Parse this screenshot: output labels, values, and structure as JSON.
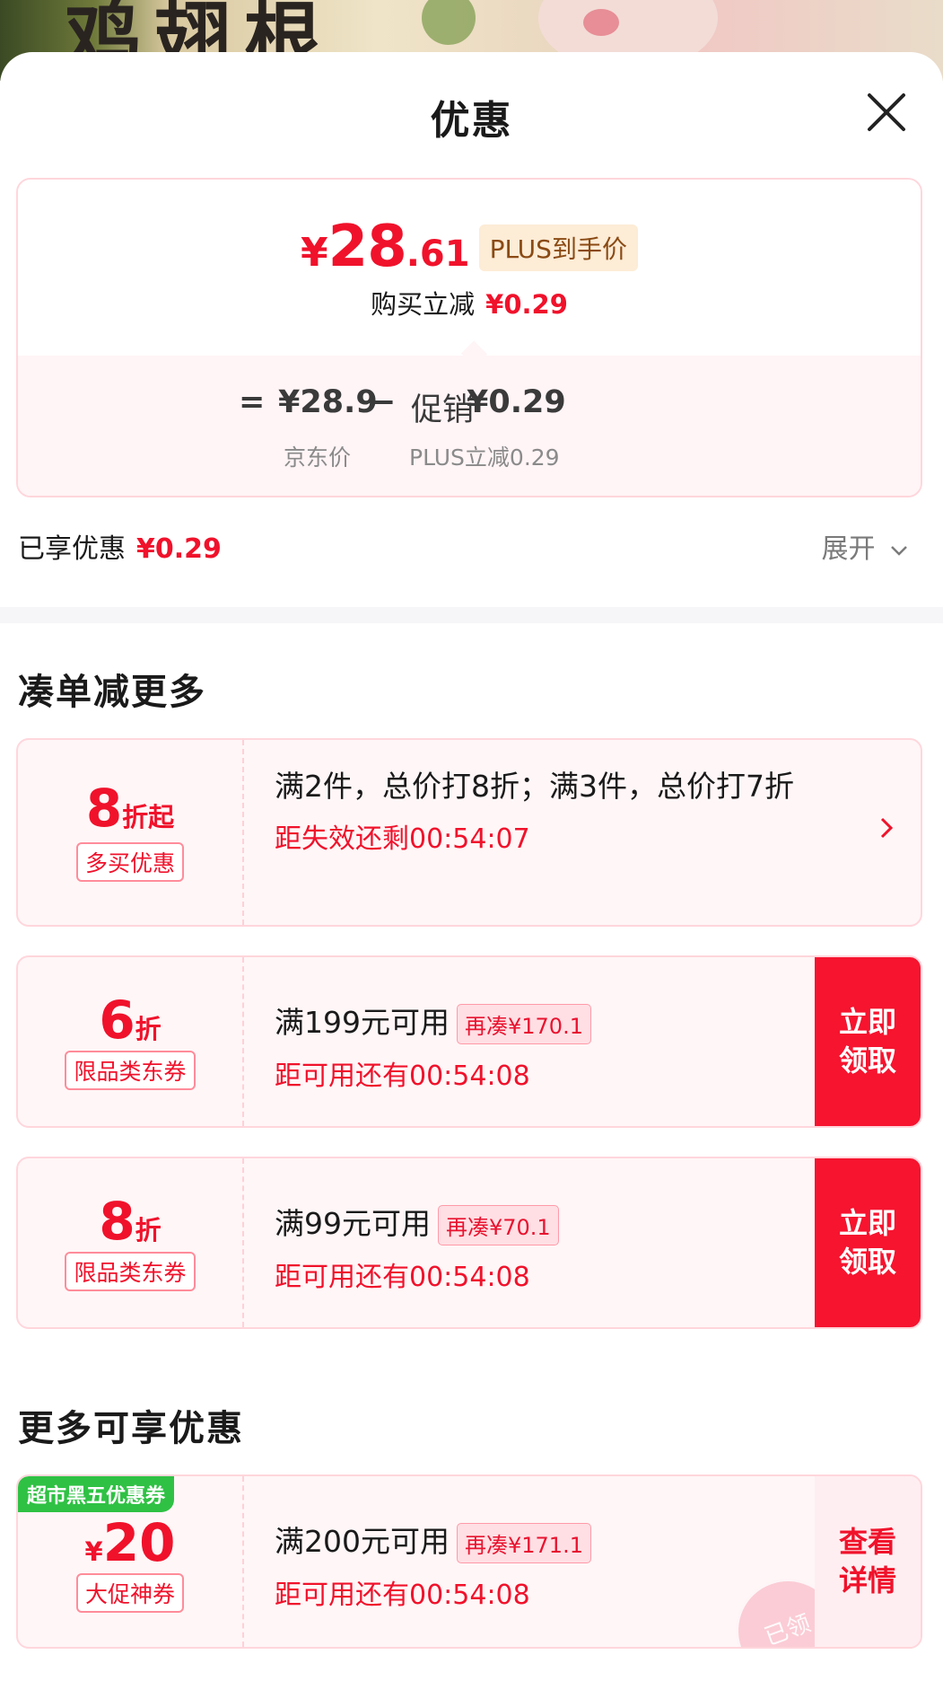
{
  "hero": {
    "text": "鸡翅根"
  },
  "sheet": {
    "title": "优惠"
  },
  "price_box": {
    "yen": "¥",
    "price_int": "28",
    "price_dec": ".61",
    "plus_tag": "PLUS到手价",
    "instant_label": "购买立减",
    "instant_value": "¥0.29",
    "eq": "=",
    "jd_price": "¥28.9",
    "minus": "−",
    "promo_label": "促销",
    "promo_value": "¥0.29",
    "jd_price_label": "京东价",
    "promo_sub": "PLUS立减0.29"
  },
  "enjoyed": {
    "label": "已享优惠",
    "value": "¥0.29",
    "expand": "展开"
  },
  "sections": {
    "more_deals": "凑单减更多",
    "more_available": "更多可享优惠"
  },
  "coupons": [
    {
      "disc_num": "8",
      "disc_unit": "折起",
      "pill": "多买优惠",
      "line1": "满2件，总价打8折；满3件，总价打7折",
      "line2": "距失效还剩00:54:07"
    },
    {
      "disc_num": "6",
      "disc_unit": "折",
      "pill": "限品类东券",
      "line1": "满199元可用",
      "tag": "再凑¥170.1",
      "line2": "距可用还有00:54:08",
      "action": "立即领取"
    },
    {
      "disc_num": "8",
      "disc_unit": "折",
      "pill": "限品类东券",
      "line1": "满99元可用",
      "tag": "再凑¥70.1",
      "line2": "距可用还有00:54:08",
      "action": "立即领取"
    },
    {
      "badge": "超市黑五优惠券",
      "yen": "¥",
      "amount": "20",
      "pill": "大促神券",
      "line1": "满200元可用",
      "tag": "再凑¥171.1",
      "line2": "距可用还有00:54:08",
      "action": "查看详情",
      "stamp": "已领"
    }
  ],
  "colors": {
    "accent": "#f0122b",
    "plus_bg": "#fdecd6",
    "badge_green": "#2fc144"
  }
}
